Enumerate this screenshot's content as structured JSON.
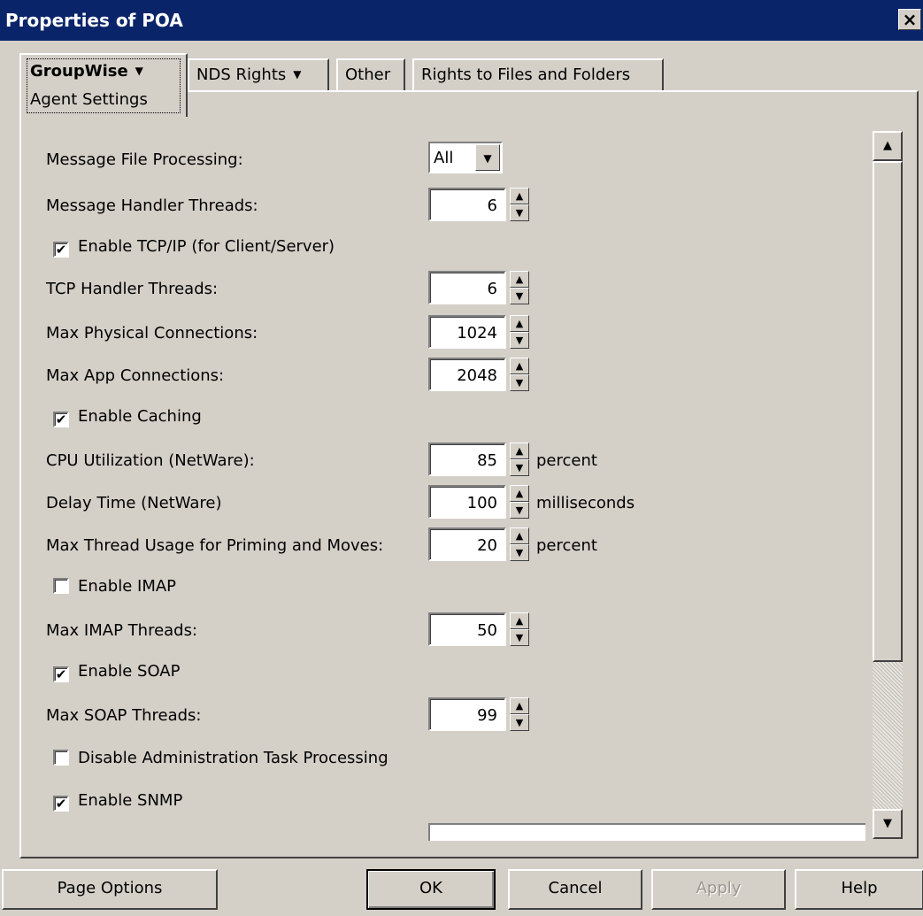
{
  "window": {
    "title": "Properties of POA",
    "close_glyph": "×"
  },
  "tabs": {
    "active": {
      "label": "GroupWise",
      "subpage": "Agent Settings",
      "has_dropdown": true
    },
    "others": [
      {
        "label": "NDS Rights",
        "has_dropdown": true
      },
      {
        "label": "Other"
      },
      {
        "label": "Rights to Files and Folders"
      }
    ]
  },
  "settings": {
    "message_file_processing": {
      "label": "Message File Processing:",
      "value": "All"
    },
    "message_handler_threads": {
      "label": "Message Handler Threads:",
      "value": "6"
    },
    "enable_tcpip": {
      "label": "Enable TCP/IP (for Client/Server)",
      "checked": true
    },
    "tcp_handler_threads": {
      "label": "TCP Handler Threads:",
      "value": "6"
    },
    "max_physical_connections": {
      "label": "Max Physical Connections:",
      "value": "1024"
    },
    "max_app_connections": {
      "label": "Max App Connections:",
      "value": "2048"
    },
    "enable_caching": {
      "label": "Enable Caching",
      "checked": true
    },
    "cpu_utilization": {
      "label": "CPU Utilization (NetWare):",
      "value": "85",
      "unit": "percent"
    },
    "delay_time": {
      "label": "Delay Time (NetWare)",
      "value": "100",
      "unit": "milliseconds"
    },
    "max_thread_usage": {
      "label": "Max Thread Usage for Priming and Moves:",
      "value": "20",
      "unit": "percent"
    },
    "enable_imap": {
      "label": "Enable IMAP",
      "checked": false
    },
    "max_imap_threads": {
      "label": "Max IMAP Threads:",
      "value": "50"
    },
    "enable_soap": {
      "label": "Enable SOAP",
      "checked": true
    },
    "max_soap_threads": {
      "label": "Max SOAP Threads:",
      "value": "99"
    },
    "disable_admin_task": {
      "label": "Disable Administration Task Processing",
      "checked": false
    },
    "enable_snmp": {
      "label": "Enable SNMP",
      "checked": true
    }
  },
  "icons": {
    "checkmark": "✔",
    "arrow_up": "▲",
    "arrow_down": "▼"
  },
  "buttons": {
    "page_options": "Page Options",
    "ok": "OK",
    "cancel": "Cancel",
    "apply": "Apply",
    "help": "Help"
  }
}
